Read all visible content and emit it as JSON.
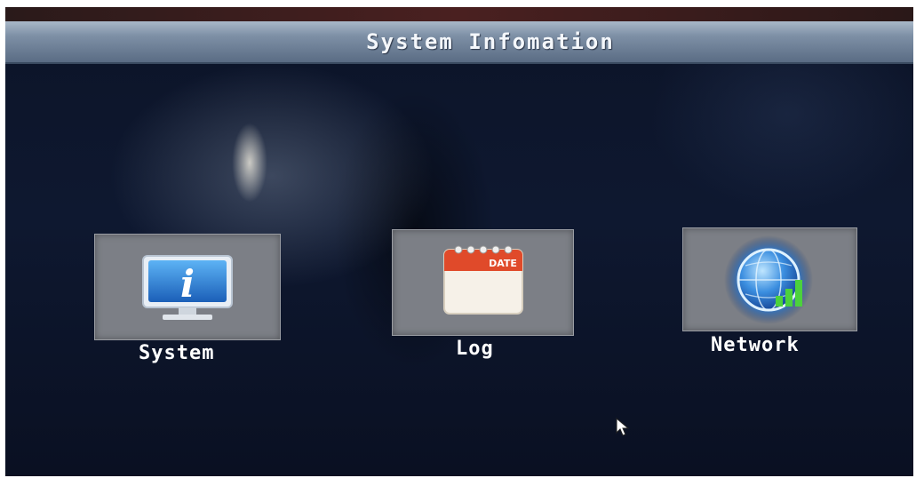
{
  "window": {
    "title": "System Infomation"
  },
  "menu": {
    "items": [
      {
        "label": "System",
        "icon": "info-monitor-icon"
      },
      {
        "label": "Log",
        "icon": "date-calendar-icon",
        "icon_text": "DATE"
      },
      {
        "label": "Network",
        "icon": "globe-signal-icon"
      }
    ]
  },
  "colors": {
    "background": "#0e1830",
    "title_bar": "#7e90a6",
    "tile": "#7c7f86",
    "text": "#ffffff"
  }
}
